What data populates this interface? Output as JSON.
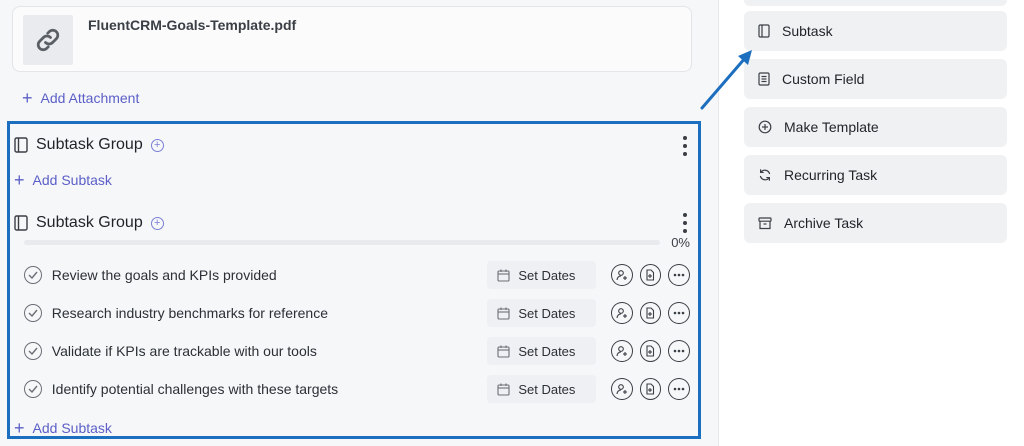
{
  "attachment": {
    "file_name": "FluentCRM-Goals-Template.pdf",
    "add_label": "Add Attachment"
  },
  "groups": [
    {
      "title": "Subtask Group",
      "add_label": "Add Subtask"
    },
    {
      "title": "Subtask Group",
      "progress_percent": 0,
      "progress_label": "0%",
      "tasks": [
        {
          "text": "Review the goals and KPIs provided",
          "dates_label": "Set Dates"
        },
        {
          "text": "Research industry benchmarks for reference",
          "dates_label": "Set Dates"
        },
        {
          "text": "Validate if KPIs are trackable with our tools",
          "dates_label": "Set Dates"
        },
        {
          "text": "Identify potential challenges with these targets",
          "dates_label": "Set Dates"
        }
      ],
      "add_label": "Add Subtask"
    }
  ],
  "menu": [
    {
      "label": "Subtask",
      "icon": "subtask-icon"
    },
    {
      "label": "Custom Field",
      "icon": "custom-field-icon"
    },
    {
      "label": "Make Template",
      "icon": "plus-circle-icon"
    },
    {
      "label": "Recurring Task",
      "icon": "recurring-icon"
    },
    {
      "label": "Archive Task",
      "icon": "archive-icon"
    }
  ],
  "colors": {
    "accent": "#5b5fc7",
    "highlight": "#1c6fbf"
  }
}
